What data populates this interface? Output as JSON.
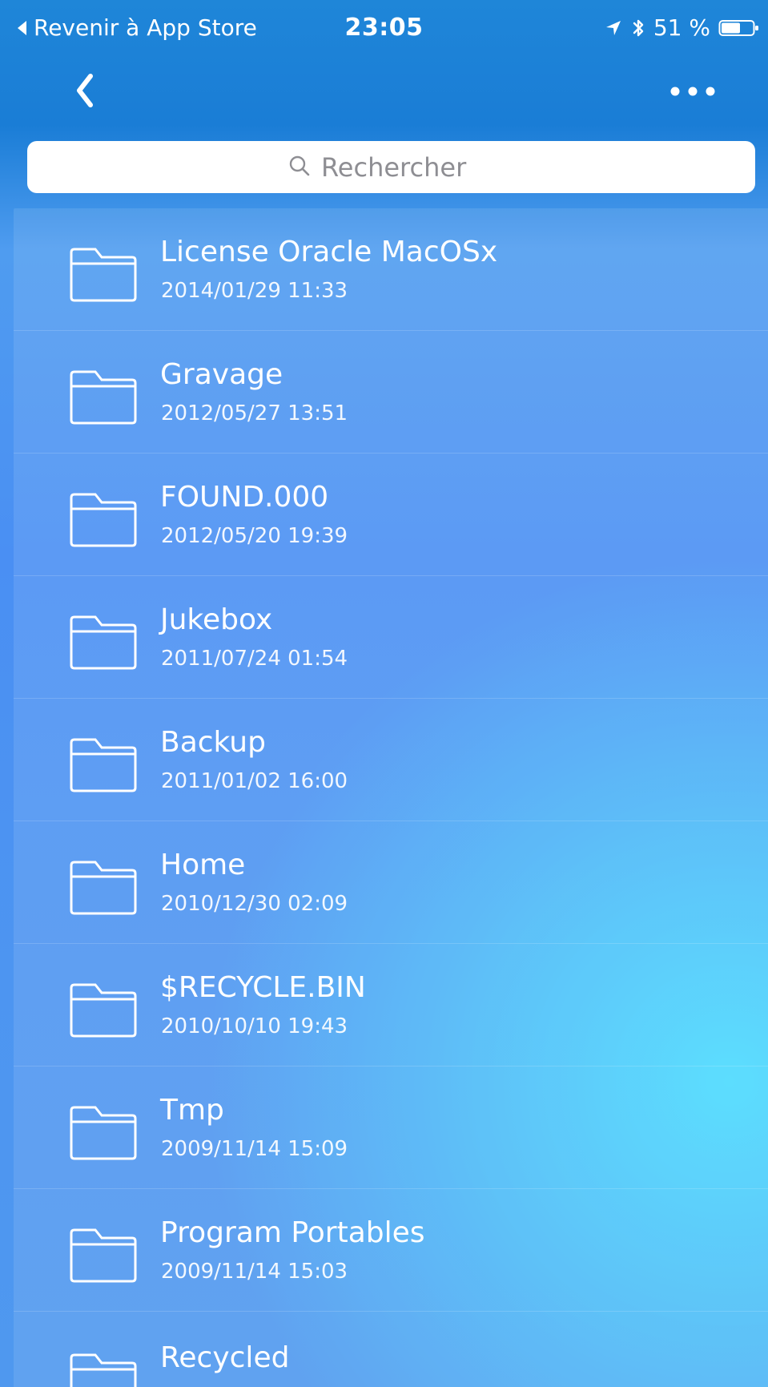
{
  "status_bar": {
    "back_to_app": "Revenir à App Store",
    "time": "23:05",
    "battery": "51 %"
  },
  "icons": {
    "back_arrow": "chevron-left-icon",
    "more": "more-horizontal-icon",
    "search": "search-icon",
    "folder": "folder-icon",
    "location": "location-arrow-icon",
    "bluetooth": "bluetooth-icon",
    "battery": "battery-icon",
    "status_back": "back-triangle-icon"
  },
  "search": {
    "placeholder": "Rechercher"
  },
  "files": [
    {
      "name": "License Oracle MacOSx",
      "date": "2014/01/29 11:33"
    },
    {
      "name": "Gravage",
      "date": "2012/05/27 13:51"
    },
    {
      "name": "FOUND.000",
      "date": "2012/05/20 19:39"
    },
    {
      "name": "Jukebox",
      "date": "2011/07/24 01:54"
    },
    {
      "name": "Backup",
      "date": "2011/01/02 16:00"
    },
    {
      "name": "Home",
      "date": "2010/12/30 02:09"
    },
    {
      "name": "$RECYCLE.BIN",
      "date": "2010/10/10 19:43"
    },
    {
      "name": "Tmp",
      "date": "2009/11/14 15:09"
    },
    {
      "name": "Program Portables",
      "date": "2009/11/14 15:03"
    },
    {
      "name": "Recycled",
      "date": ""
    }
  ],
  "colors": {
    "accent": "#1a7dd6",
    "list_bg": "#4d95f1",
    "glow": "#4adeff",
    "white": "#ffffff"
  }
}
